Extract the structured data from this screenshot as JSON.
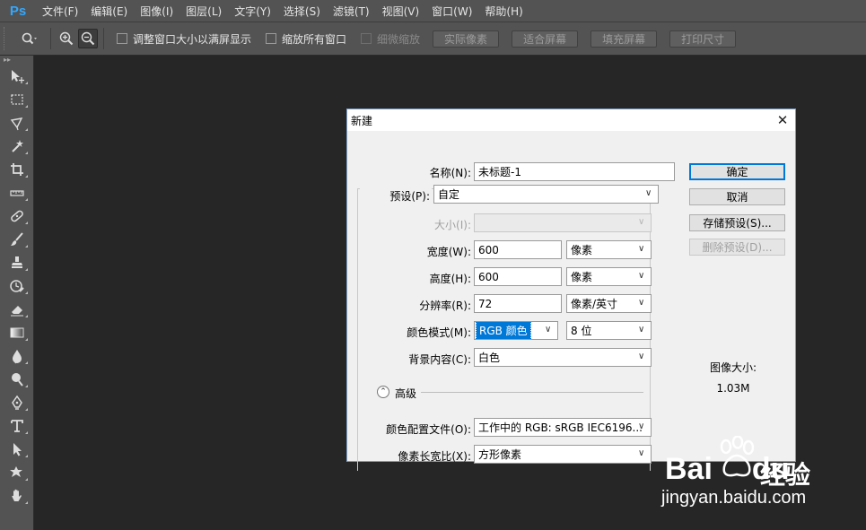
{
  "app": {
    "logo": "Ps"
  },
  "menu": [
    "文件(F)",
    "编辑(E)",
    "图像(I)",
    "图层(L)",
    "文字(Y)",
    "选择(S)",
    "滤镜(T)",
    "视图(V)",
    "窗口(W)",
    "帮助(H)"
  ],
  "options": {
    "tool_icon": "zoom-icon",
    "check_resize_windows": "调整窗口大小以满屏显示",
    "check_zoom_all": "缩放所有窗口",
    "check_scrubby": "细微缩放",
    "btn_actual_pixels": "实际像素",
    "btn_fit_screen": "适合屏幕",
    "btn_fill_screen": "填充屏幕",
    "btn_print_size": "打印尺寸"
  },
  "tools": [
    "move-tool-icon",
    "marquee-tool-icon",
    "lasso-tool-icon",
    "magic-wand-tool-icon",
    "crop-tool-icon",
    "ruler-tool-icon",
    "healing-brush-tool-icon",
    "brush-tool-icon",
    "stamp-tool-icon",
    "history-brush-tool-icon",
    "eraser-tool-icon",
    "gradient-tool-icon",
    "blur-tool-icon",
    "dodge-tool-icon",
    "pen-tool-icon",
    "type-tool-icon",
    "path-selection-tool-icon",
    "shape-tool-icon",
    "hand-tool-icon"
  ],
  "dialog": {
    "title": "新建",
    "name_label": "名称(N):",
    "name_value": "未标题-1",
    "preset_label": "预设(P):",
    "preset_value": "自定",
    "size_label": "大小(I):",
    "size_value": "",
    "width_label": "宽度(W):",
    "width_value": "600",
    "width_unit": "像素",
    "height_label": "高度(H):",
    "height_value": "600",
    "height_unit": "像素",
    "resolution_label": "分辨率(R):",
    "resolution_value": "72",
    "resolution_unit": "像素/英寸",
    "color_mode_label": "颜色模式(M):",
    "color_mode_value": "RGB 颜色",
    "bit_depth_value": "8 位",
    "background_label": "背景内容(C):",
    "background_value": "白色",
    "advanced_label": "高级",
    "color_profile_label": "颜色配置文件(O):",
    "color_profile_value": "工作中的 RGB: sRGB IEC6196...",
    "pixel_aspect_label": "像素长宽比(X):",
    "pixel_aspect_value": "方形像素",
    "ok_button": "确定",
    "cancel_button": "取消",
    "save_preset_button": "存储预设(S)...",
    "delete_preset_button": "删除预设(D)...",
    "image_size_label": "图像大小:",
    "image_size_value": "1.03M"
  },
  "watermark": {
    "logo_text_a": "Bai",
    "logo_text_b": "du",
    "logo_cn": "经验",
    "url": "jingyan.baidu.com"
  },
  "colors": {
    "ps_blue": "#31a8ff",
    "panel_bg": "#535353",
    "canvas_bg": "#262626",
    "dialog_bg": "#f0f0f0",
    "selection_blue": "#0078d7"
  }
}
